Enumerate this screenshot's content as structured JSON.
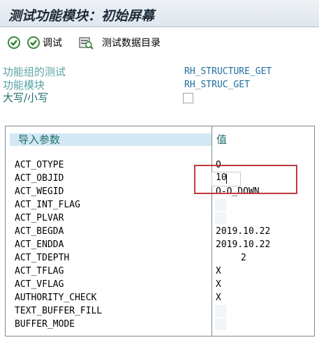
{
  "title": "测试功能模块：初始屏幕",
  "toolbar": {
    "execute_icon": "execute-icon",
    "debug_label": "调试",
    "testdata_label": "测试数据目录"
  },
  "form": {
    "group_label": "功能组的测试",
    "group_value": "RH_STRUCTURE_GET",
    "module_label": "功能模块",
    "module_value": "RH_STRUC_GET",
    "case_label": "大写/小写"
  },
  "table": {
    "col_param": "导入参数",
    "col_value": "值",
    "rows": [
      {
        "name": "ACT_OTYPE",
        "value": "O"
      },
      {
        "name": "ACT_OBJID",
        "value": "10"
      },
      {
        "name": "ACT_WEGID",
        "value": "O-O_DOWN"
      },
      {
        "name": "ACT_INT_FLAG",
        "value": ""
      },
      {
        "name": "ACT_PLVAR",
        "value": ""
      },
      {
        "name": "ACT_BEGDA",
        "value": "2019.10.22"
      },
      {
        "name": "ACT_ENDDA",
        "value": "2019.10.22"
      },
      {
        "name": "ACT_TDEPTH",
        "value": "2"
      },
      {
        "name": "ACT_TFLAG",
        "value": "X"
      },
      {
        "name": "ACT_VFLAG",
        "value": "X"
      },
      {
        "name": "AUTHORITY_CHECK",
        "value": "X"
      },
      {
        "name": "TEXT_BUFFER_FILL",
        "value": ""
      },
      {
        "name": "BUFFER_MODE",
        "value": ""
      }
    ]
  }
}
